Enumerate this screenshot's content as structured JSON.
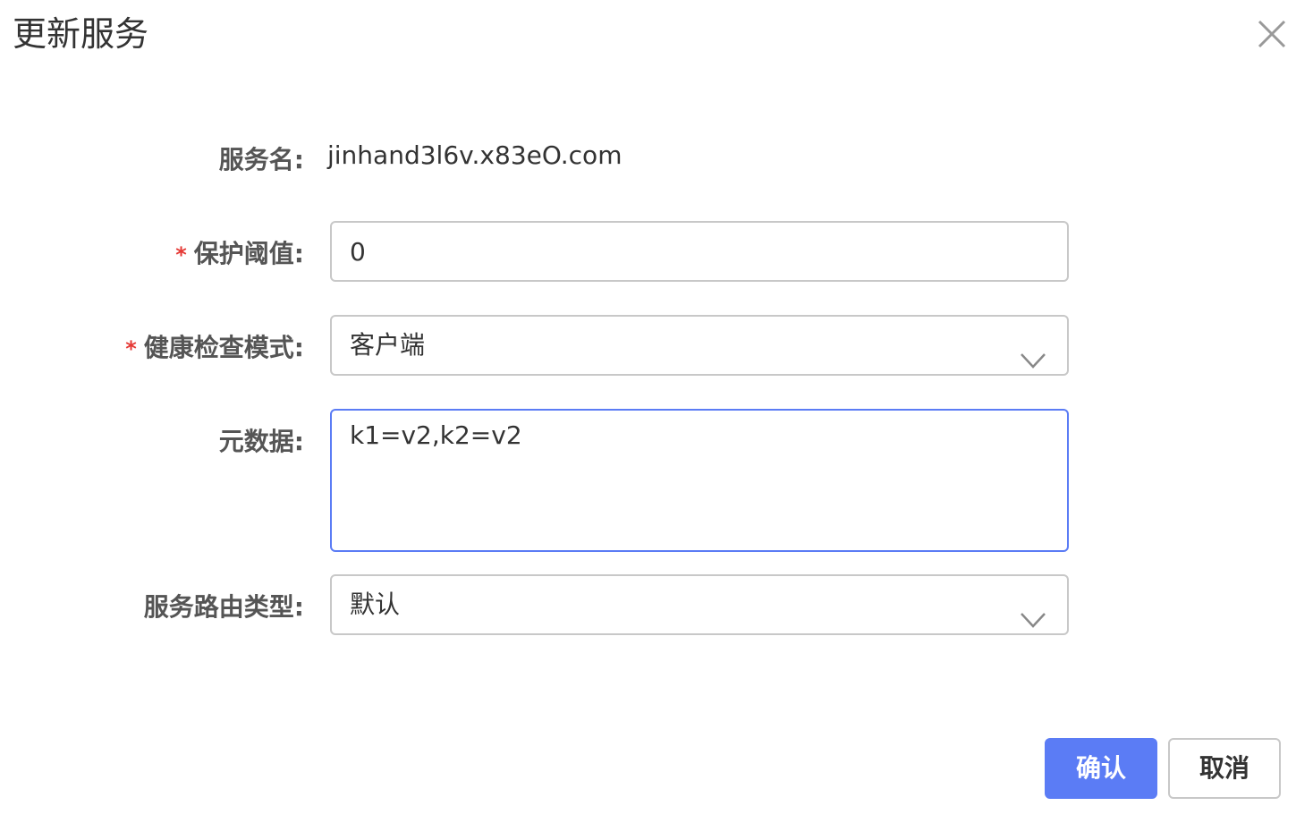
{
  "dialog": {
    "title": "更新服务",
    "close_icon": "close-icon"
  },
  "form": {
    "service_name": {
      "label": "服务名:",
      "value": "jinhand3l6v.x83eO.com"
    },
    "protect_threshold": {
      "required_mark": "*",
      "label": "保护阈值:",
      "value": "0"
    },
    "health_check_mode": {
      "required_mark": "*",
      "label": "健康检查模式:",
      "selected": "客户端",
      "icon": "chevron-down-icon"
    },
    "metadata": {
      "label": "元数据:",
      "value": "k1=v2,k2=v2"
    },
    "route_type": {
      "label": "服务路由类型:",
      "selected": "默认",
      "icon": "chevron-down-icon"
    }
  },
  "footer": {
    "confirm_label": "确认",
    "cancel_label": "取消"
  },
  "colors": {
    "primary": "#5b7cf5",
    "required": "#e53935",
    "border": "#c8c8c8"
  }
}
